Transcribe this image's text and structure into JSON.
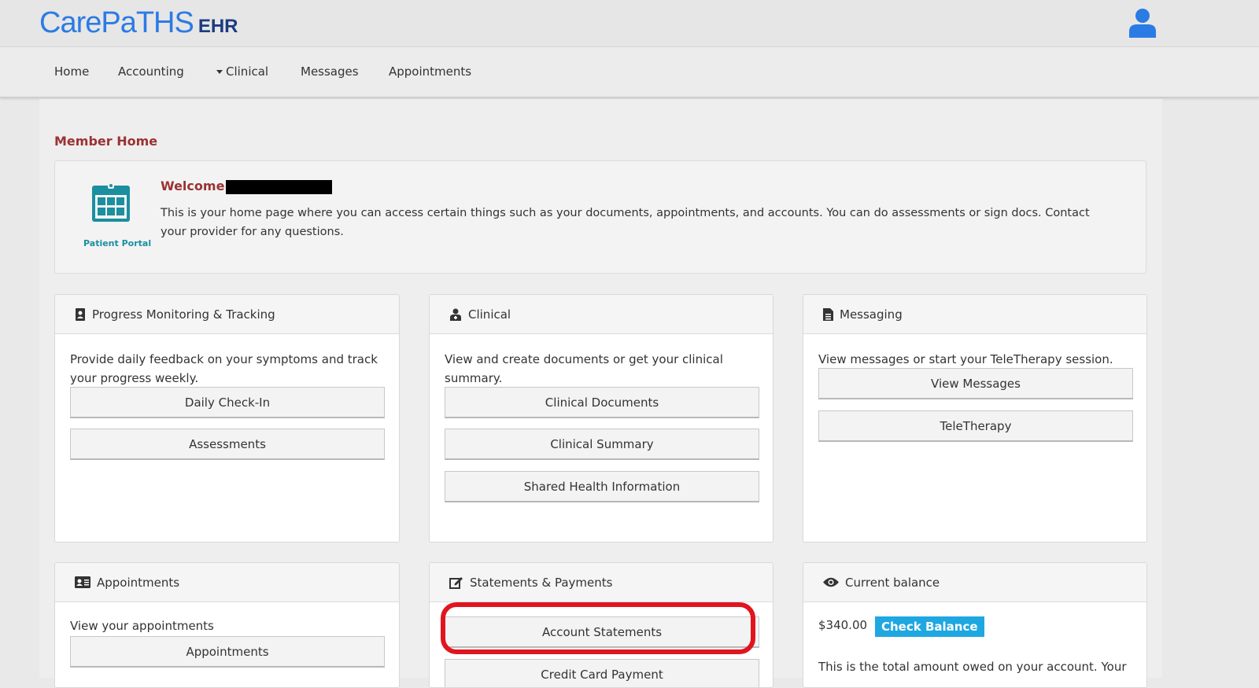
{
  "header": {
    "logo_main": "CarePaTHS",
    "logo_ehr": "EHR"
  },
  "nav": {
    "home": "Home",
    "accounting": "Accounting",
    "clinical": "Clinical",
    "messages": "Messages",
    "appointments": "Appointments"
  },
  "page_title": "Member Home",
  "welcome": {
    "title": "Welcome",
    "text": "This is your home page where you can access certain things such as your documents, appointments, and accounts. You can do assessments or sign docs. Contact your provider for any questions.",
    "portal_label": "Patient Portal"
  },
  "panels": {
    "progress": {
      "title": "Progress Monitoring & Tracking",
      "desc": "Provide daily feedback on your symptoms and track your progress weekly.",
      "buttons": [
        "Daily Check-In",
        "Assessments"
      ]
    },
    "clinical": {
      "title": "Clinical",
      "desc": "View and create documents or get your clinical summary.",
      "buttons": [
        "Clinical Documents",
        "Clinical Summary",
        "Shared Health Information"
      ]
    },
    "messaging": {
      "title": "Messaging",
      "desc": "View messages or start your TeleTherapy session.",
      "buttons": [
        "View Messages",
        "TeleTherapy"
      ]
    },
    "appointments": {
      "title": "Appointments",
      "desc": "View your appointments",
      "buttons": [
        "Appointments"
      ]
    },
    "statements": {
      "title": "Statements & Payments",
      "buttons": [
        "Account Statements",
        "Credit Card Payment"
      ]
    },
    "balance": {
      "title": "Current balance",
      "amount": "$340.00",
      "check_label": "Check Balance",
      "text": "This is the total amount owed on your account. Your"
    }
  },
  "colors": {
    "brand_blue": "#2b7be4",
    "title_red": "#9b3232",
    "highlight_red": "#e0151f",
    "check_balance_blue": "#1ea7e1"
  }
}
